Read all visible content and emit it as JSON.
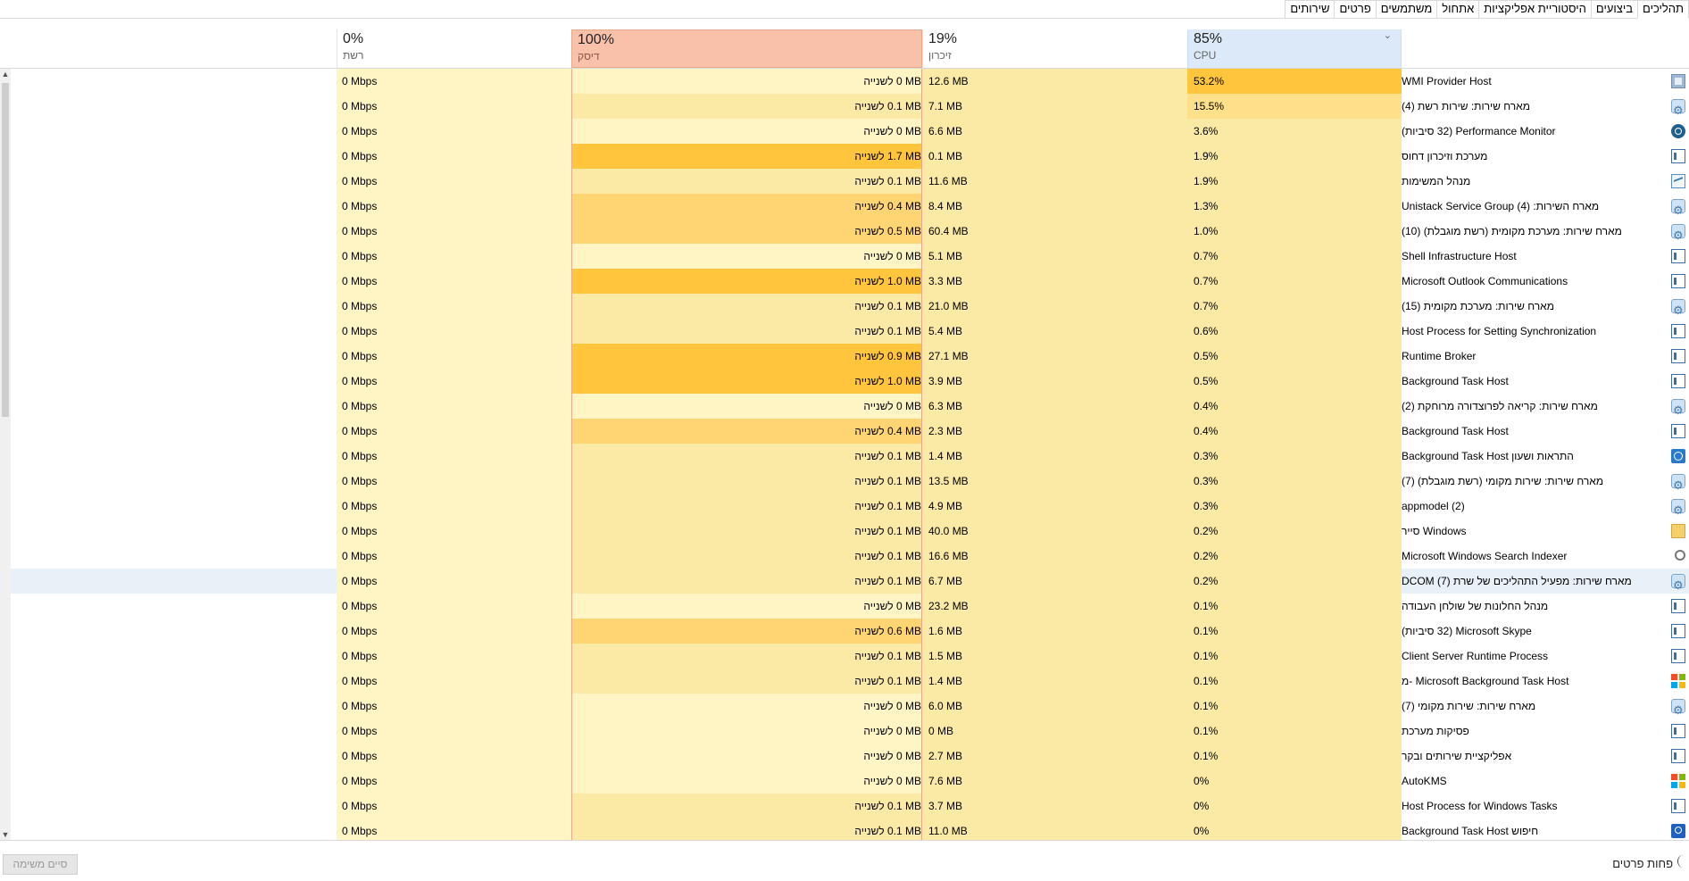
{
  "tabs": [
    "תהליכים",
    "ביצועים",
    "היסטוריית אפליקציות",
    "אתחול",
    "משתמשים",
    "פרטים",
    "שירותים"
  ],
  "corner_label": "תהליכים",
  "header": {
    "net": {
      "pct": "0%",
      "label": "רשת"
    },
    "disk": {
      "pct": "100%",
      "label": "דיסק"
    },
    "mem": {
      "pct": "19%",
      "label": "זיכרון"
    },
    "cpu": {
      "pct": "85%",
      "label": "CPU"
    }
  },
  "colors": {
    "cpu_heavy": "#ffc53d",
    "cpu_mid": "#ffe08a",
    "light": "#fff4c4",
    "mid": "#fbe9a6",
    "strong": "#ffd574",
    "selected": "#e8f0f8"
  },
  "processes": [
    {
      "name": "WMI Provider Host",
      "icon": "wmi-icon",
      "cpu": "53.2%",
      "mem": "12.6 MB",
      "disk": "0 MB",
      "net": "0 Mbps"
    },
    {
      "name": "מארח שירות: שירות רשת (4)",
      "icon": "gear-icon",
      "cpu": "15.5%",
      "mem": "7.1 MB",
      "disk": "0.1 MB",
      "net": "0 Mbps"
    },
    {
      "name": "Performance Monitor (32 סיביות)",
      "icon": "perfmon-icon",
      "cpu": "3.6%",
      "mem": "6.6 MB",
      "disk": "0 MB",
      "net": "0 Mbps"
    },
    {
      "name": "מערכת וזיכרון דחוס",
      "icon": "window-icon",
      "cpu": "1.9%",
      "mem": "0.1 MB",
      "disk": "1.7 MB",
      "net": "0 Mbps"
    },
    {
      "name": "מנהל המשימות",
      "icon": "taskmgr-icon",
      "cpu": "1.9%",
      "mem": "11.6 MB",
      "disk": "0.1 MB",
      "net": "0 Mbps"
    },
    {
      "name": "מארח השירות: Unistack Service Group (4)",
      "icon": "gear-icon",
      "cpu": "1.3%",
      "mem": "8.4 MB",
      "disk": "0.4 MB",
      "net": "0 Mbps"
    },
    {
      "name": "מארח שירות: מערכת מקומית (רשת מוגבלת) (10)",
      "icon": "gear-icon",
      "cpu": "1.0%",
      "mem": "60.4 MB",
      "disk": "0.5 MB",
      "net": "0 Mbps"
    },
    {
      "name": "Shell Infrastructure Host",
      "icon": "window-icon",
      "cpu": "0.7%",
      "mem": "5.1 MB",
      "disk": "0 MB",
      "net": "0 Mbps"
    },
    {
      "name": "Microsoft Outlook Communications",
      "icon": "window-icon",
      "cpu": "0.7%",
      "mem": "3.3 MB",
      "disk": "1.0 MB",
      "net": "0 Mbps"
    },
    {
      "name": "מארח שירות: מערכת מקומית (15)",
      "icon": "gear-icon",
      "cpu": "0.7%",
      "mem": "21.0 MB",
      "disk": "0.1 MB",
      "net": "0 Mbps"
    },
    {
      "name": "Host Process for Setting Synchronization",
      "icon": "window-icon",
      "cpu": "0.6%",
      "mem": "5.4 MB",
      "disk": "0.1 MB",
      "net": "0 Mbps"
    },
    {
      "name": "Runtime Broker",
      "icon": "window-icon",
      "cpu": "0.5%",
      "mem": "27.1 MB",
      "disk": "0.9 MB",
      "net": "0 Mbps"
    },
    {
      "name": "Background Task Host",
      "icon": "window-icon",
      "cpu": "0.5%",
      "mem": "3.9 MB",
      "disk": "1.0 MB",
      "net": "0 Mbps"
    },
    {
      "name": "מארח שירות: קריאה לפרוצדורה מרוחקת (2)",
      "icon": "gear-icon",
      "cpu": "0.4%",
      "mem": "6.3 MB",
      "disk": "0 MB",
      "net": "0 Mbps"
    },
    {
      "name": "Background Task Host",
      "icon": "window-icon",
      "cpu": "0.4%",
      "mem": "2.3 MB",
      "disk": "0.4 MB",
      "net": "0 Mbps"
    },
    {
      "name": "התראות ושעון Background Task Host",
      "icon": "clock-icon",
      "cpu": "0.3%",
      "mem": "1.4 MB",
      "disk": "0.1 MB",
      "net": "0 Mbps"
    },
    {
      "name": "מארח שירות: שירות מקומי (רשת מוגבלת) (7)",
      "icon": "gear-icon",
      "cpu": "0.3%",
      "mem": "13.5 MB",
      "disk": "0.1 MB",
      "net": "0 Mbps"
    },
    {
      "name": "appmodel (2)",
      "icon": "gear-icon",
      "cpu": "0.3%",
      "mem": "4.9 MB",
      "disk": "0.1 MB",
      "net": "0 Mbps"
    },
    {
      "name": "Windows סייר",
      "icon": "folder-icon",
      "cpu": "0.2%",
      "mem": "40.0 MB",
      "disk": "0.1 MB",
      "net": "0 Mbps"
    },
    {
      "name": "Microsoft Windows Search Indexer",
      "icon": "search-icon",
      "cpu": "0.2%",
      "mem": "16.6 MB",
      "disk": "0.1 MB",
      "net": "0 Mbps"
    },
    {
      "name": "מארח שירות: מפעיל התהליכים של שרת DCOM (7)",
      "icon": "gear-icon",
      "cpu": "0.2%",
      "mem": "6.7 MB",
      "disk": "0.1 MB",
      "net": "0 Mbps",
      "selected": true
    },
    {
      "name": "מנהל החלונות של שולחן העבודה",
      "icon": "window-icon",
      "cpu": "0.1%",
      "mem": "23.2 MB",
      "disk": "0 MB",
      "net": "0 Mbps"
    },
    {
      "name": "Microsoft Skype (32 סיביות)",
      "icon": "window-icon",
      "cpu": "0.1%",
      "mem": "1.6 MB",
      "disk": "0.6 MB",
      "net": "0 Mbps"
    },
    {
      "name": "Client Server Runtime Process",
      "icon": "window-icon",
      "cpu": "0.1%",
      "mem": "1.5 MB",
      "disk": "0.1 MB",
      "net": "0 Mbps"
    },
    {
      "name": "Microsoft Background Task Host -מ",
      "icon": "ms-icon",
      "cpu": "0.1%",
      "mem": "1.4 MB",
      "disk": "0.1 MB",
      "net": "0 Mbps"
    },
    {
      "name": "מארח שירות: שירות מקומי (7)",
      "icon": "gear-icon",
      "cpu": "0.1%",
      "mem": "6.0 MB",
      "disk": "0 MB",
      "net": "0 Mbps"
    },
    {
      "name": "פסיקות מערכת",
      "icon": "window-icon",
      "cpu": "0.1%",
      "mem": "0 MB",
      "disk": "0 MB",
      "net": "0 Mbps"
    },
    {
      "name": "אפליקציית שירותים ובקר",
      "icon": "window-icon",
      "cpu": "0.1%",
      "mem": "2.7 MB",
      "disk": "0 MB",
      "net": "0 Mbps"
    },
    {
      "name": "AutoKMS",
      "icon": "ms-icon",
      "cpu": "0%",
      "mem": "7.6 MB",
      "disk": "0 MB",
      "net": "0 Mbps"
    },
    {
      "name": "Host Process for Windows Tasks",
      "icon": "window-icon",
      "cpu": "0%",
      "mem": "3.7 MB",
      "disk": "0.1 MB",
      "net": "0 Mbps"
    },
    {
      "name": "חיפוש Background Task Host",
      "icon": "search-blue-icon",
      "cpu": "0%",
      "mem": "11.0 MB",
      "disk": "0.1 MB",
      "net": "0 Mbps"
    }
  ],
  "disk_unit_suffix": "לשנייה",
  "footer": {
    "end_task": "סיים משימה",
    "fewer_details": "פחות פרטים"
  }
}
